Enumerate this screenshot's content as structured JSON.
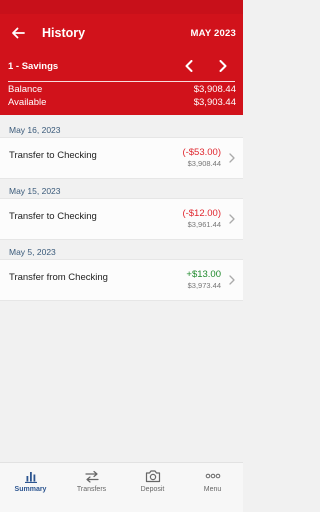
{
  "header": {
    "title": "History",
    "month": "MAY 2023",
    "account": "1 - Savings",
    "balance_label": "Balance",
    "balance_value": "$3,908.44",
    "available_label": "Available",
    "available_value": "$3,903.44"
  },
  "transactions": [
    {
      "date": "May 16, 2023",
      "description": "Transfer to Checking",
      "amount": "(-$53.00)",
      "balance": "$3,908.44",
      "sign": "negative"
    },
    {
      "date": "May 15, 2023",
      "description": "Transfer to Checking",
      "amount": "(-$12.00)",
      "balance": "$3,961.44",
      "sign": "negative"
    },
    {
      "date": "May 5, 2023",
      "description": "Transfer from Checking",
      "amount": "+$13.00",
      "balance": "$3,973.44",
      "sign": "positive"
    }
  ],
  "tabbar": {
    "items": [
      {
        "label": "Summary",
        "icon": "bar-chart-icon",
        "active": true
      },
      {
        "label": "Transfers",
        "icon": "transfer-arrows-icon",
        "active": false
      },
      {
        "label": "Deposit",
        "icon": "camera-icon",
        "active": false
      },
      {
        "label": "Menu",
        "icon": "more-dots-icon",
        "active": false
      }
    ]
  },
  "colors": {
    "header_red": "#d1121b",
    "negative": "#e0262e",
    "positive": "#1f8a2c",
    "active_tab": "#2c5590",
    "date_text": "#3a5a7a"
  }
}
